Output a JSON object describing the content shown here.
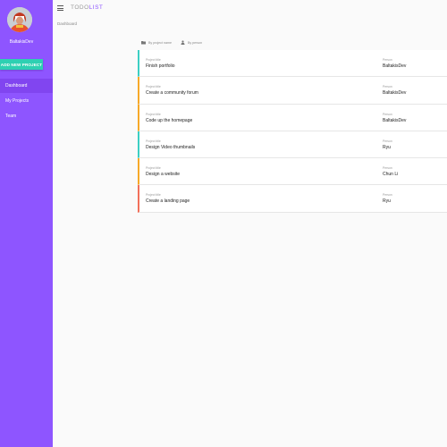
{
  "app": {
    "title_part1": "TODO",
    "title_part2": "LIST"
  },
  "user": {
    "name": "BaltakisDev"
  },
  "sidebar": {
    "add_button_label": "ADD NEW PROJECT",
    "items": [
      {
        "label": "Dashboard",
        "active": true
      },
      {
        "label": "My Projects",
        "active": false
      },
      {
        "label": "Team",
        "active": false
      }
    ]
  },
  "page": {
    "title": "Dashboard"
  },
  "sort": {
    "by_project_label": "By project name",
    "by_person_label": "By person"
  },
  "projects": {
    "title_label": "Project title",
    "person_label": "Person",
    "rows": [
      {
        "title": "Finish portfolio",
        "person": "BaltakisDev",
        "status_color": "#3ccfc3"
      },
      {
        "title": "Create a community forum",
        "person": "BaltakisDev",
        "status_color": "#f7a928"
      },
      {
        "title": "Code up the homepage",
        "person": "BaltakisDev",
        "status_color": "#f7a928"
      },
      {
        "title": "Design Video thumbnails",
        "person": "Ryu",
        "status_color": "#3ccfc3"
      },
      {
        "title": "Design a website",
        "person": "Chun Li",
        "status_color": "#f7a928"
      },
      {
        "title": "Create a landing page",
        "person": "Ryu",
        "status_color": "#f2705a"
      }
    ]
  },
  "colors": {
    "sidebar_bg": "#8e55ff",
    "sidebar_active": "#8145f0",
    "accent_green": "#2ed0b2",
    "brand_purple": "#8e55ff"
  },
  "icons": {
    "menu": "hamburger-menu-icon",
    "folder": "folder-icon",
    "person": "person-icon"
  }
}
